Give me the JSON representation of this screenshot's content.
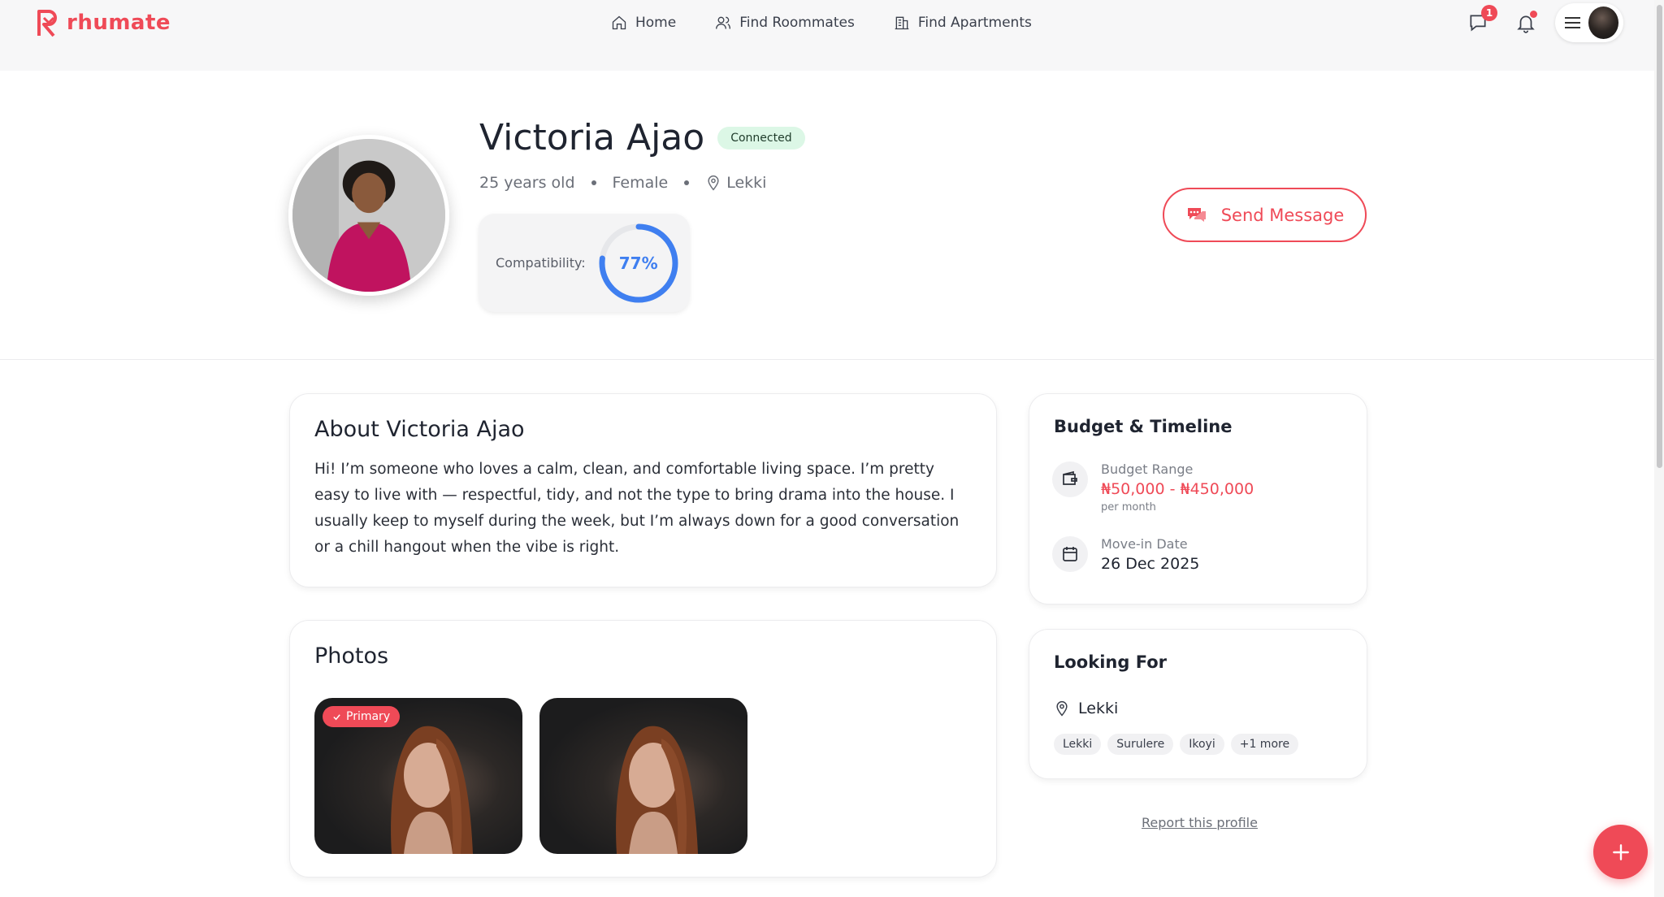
{
  "brand": {
    "name": "rhumate",
    "accent": "#ef4a57"
  },
  "nav": {
    "links": [
      {
        "label": "Home",
        "icon": "home-icon"
      },
      {
        "label": "Find Roommates",
        "icon": "users-icon"
      },
      {
        "label": "Find Apartments",
        "icon": "building-icon"
      }
    ],
    "messages_badge": "1"
  },
  "profile": {
    "name": "Victoria Ajao",
    "status": "Connected",
    "age": "25 years old",
    "gender": "Female",
    "location": "Lekki",
    "compat_label": "Compatibility:",
    "compat_value": "77%",
    "compat_percent": 77,
    "send_message": "Send Message"
  },
  "about": {
    "title": "About Victoria Ajao",
    "text": "Hi! I’m someone who loves a calm, clean, and comfortable living space. I’m pretty easy to live with — respectful, tidy, and not the type to bring drama into the house. I usually keep to myself during the week, but I’m always down for a good conversation or a chill hangout when the vibe is right."
  },
  "photos": {
    "title": "Photos",
    "primary_label": "Primary"
  },
  "budget": {
    "title": "Budget & Timeline",
    "range_label": "Budget Range",
    "range_value": "₦50,000 - ₦450,000",
    "range_sub": "per month",
    "movein_label": "Move-in Date",
    "movein_value": "26 Dec 2025"
  },
  "looking": {
    "title": "Looking For",
    "location": "Lekki",
    "chips": [
      "Lekki",
      "Surulere",
      "Ikoyi",
      "+1 more"
    ]
  },
  "report": "Report this profile"
}
